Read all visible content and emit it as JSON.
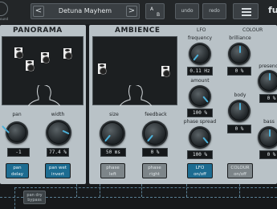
{
  "topbar": {
    "logo_sub": "ound",
    "preset_prev": "<",
    "preset_name": "Detuna Mayhem",
    "preset_next": ">",
    "ab_a": "A",
    "ab_b": "B",
    "undo": "undo",
    "redo": "redo",
    "brand": "fu"
  },
  "panorama": {
    "title": "PANORAMA",
    "pan_label": "pan",
    "pan_value": "-1",
    "width_label": "width",
    "width_value": "77.4 %",
    "pan_delay": "pan\ndelay",
    "pan_wet_invert": "pan wet\ninvert"
  },
  "ambience": {
    "title": "AMBIENCE",
    "size_label": "size",
    "size_value": "50 ms",
    "feedback_label": "feedback",
    "feedback_value": "0 %",
    "phase_left": "phase\nleft",
    "phase_right": "phase\nright"
  },
  "lfo": {
    "title": "LFO",
    "frequency_label": "frequency",
    "frequency_value": "0.11 Hz",
    "amount_label": "amount",
    "amount_value": "100 %",
    "phase_spread_label": "phase spread",
    "phase_spread_value": "100 %",
    "lfo_onoff": "LFO\non/off"
  },
  "colour": {
    "title": "COLOUR",
    "brilliance_label": "brilliance",
    "brilliance_value": "0 %",
    "body_label": "body",
    "body_value": "0 %",
    "presence_label": "presence",
    "presence_value": "0 %",
    "bass_label": "bass",
    "bass_value": "0 %",
    "colour_onoff": "COLOUR\non/off"
  },
  "bottom": {
    "pan_dry_bypass": "pan dry\nbypass"
  },
  "colors": {
    "accent": "#4db0d8",
    "active_button": "#1d6c91",
    "panel": "#b9c2c7"
  }
}
